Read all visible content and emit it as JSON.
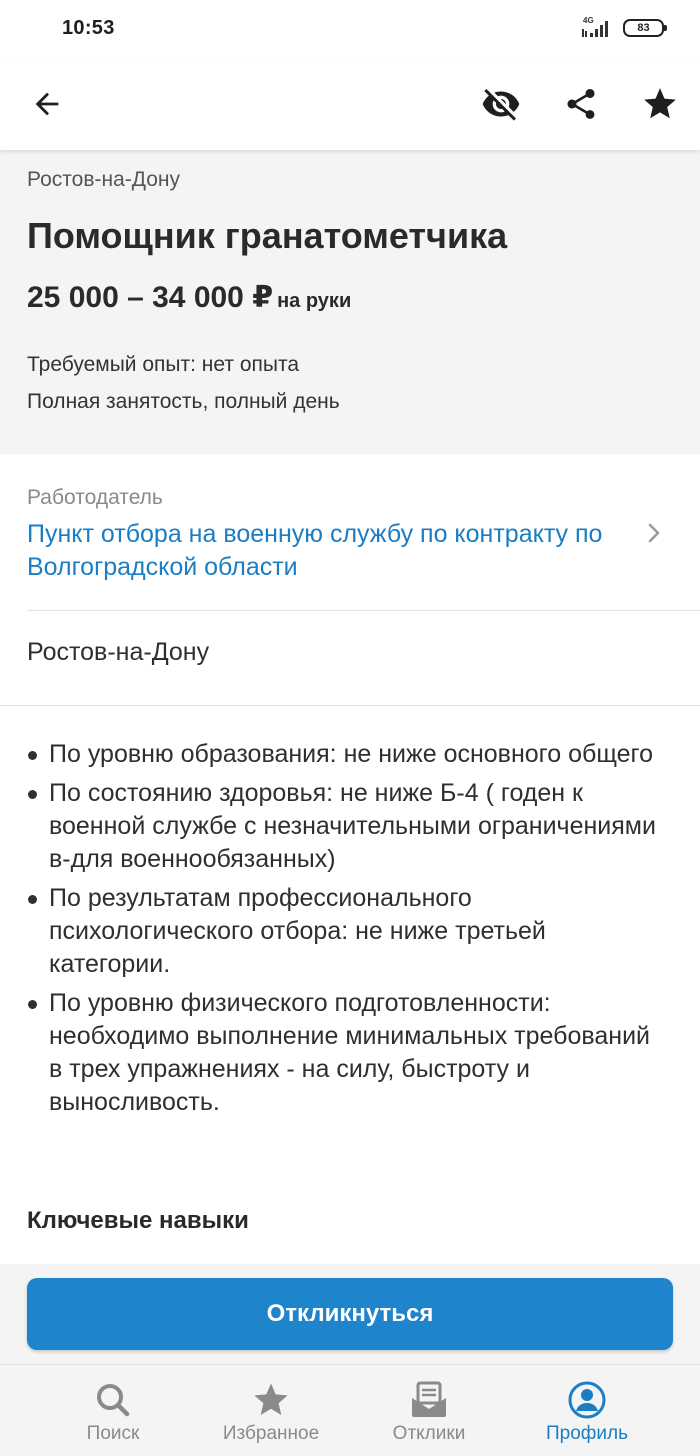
{
  "status_bar": {
    "time": "10:53",
    "network": "4G",
    "battery": "83"
  },
  "toolbar": {
    "back_icon": "arrow-left-icon",
    "hide_icon": "eye-off-icon",
    "share_icon": "share-icon",
    "favorite_icon": "star-icon"
  },
  "vacancy": {
    "city": "Ростов-на-Дону",
    "title": "Помощник гранатометчика",
    "salary": "25 000 – 34 000 ₽",
    "salary_note": "на руки",
    "experience": "Требуемый опыт: нет опыта",
    "employment": "Полная занятость, полный день"
  },
  "employer": {
    "label": "Работодатель",
    "name": "Пункт отбора на военную службу по контракту по Волгоградской области"
  },
  "location": "Ростов-на-Дону",
  "requirements": [
    "По уровню образования: не ниже основного общего",
    "По состоянию здоровья: не ниже Б-4 ( годен к военной службе с незначительными ограничениями в-для военнообязанных)",
    "По результатам профессионального психологического отбора: не ниже третьей категории.",
    "По уровню физического подготовленности: необходимо выполнение минимальных требований в трех упражнениях - на силу, быстроту и выносливость."
  ],
  "skills_title": "Ключевые навыки",
  "apply_button": "Откликнуться",
  "bottom_nav": [
    {
      "label": "Поиск",
      "icon": "search-icon"
    },
    {
      "label": "Избранное",
      "icon": "star-icon"
    },
    {
      "label": "Отклики",
      "icon": "responses-icon"
    },
    {
      "label": "Профиль",
      "icon": "profile-icon"
    }
  ],
  "colors": {
    "accent": "#1e84cc",
    "link": "#1b7dc3",
    "header_bg": "#f4f4f4"
  }
}
